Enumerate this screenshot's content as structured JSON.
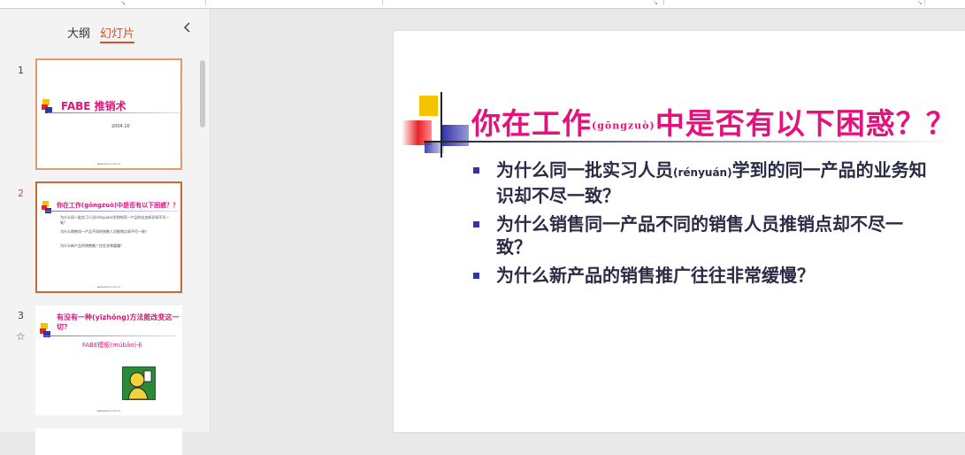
{
  "panel": {
    "tab_outline": "大纲",
    "tab_slides": "幻灯片",
    "collapse_icon": "chevron-left-icon"
  },
  "slides": [
    {
      "number": "1",
      "title": "FABE 推销术",
      "date": "2004.10",
      "footer": "www.zixin.com.cn"
    },
    {
      "number": "2",
      "title": "你在工作(gōngzuò)中是否有以下困惑？？",
      "bullets": [
        "为什么同一批实习人员(rényuán)学到的同一产品的业务知识却不尽一致？",
        "为什么销售同一产品不同的销售人员推销点却不尽一致？",
        "为什么新产品的销售推广往往非常缓慢？"
      ],
      "footer": "www.zixin.com.cn"
    },
    {
      "number": "3",
      "title": "有没有一种(yīzhǒng)方法能改变这一切？",
      "subtitle": "FABE模板(múbǎn)卡",
      "footer": "www.zixin.com.cn"
    }
  ],
  "main_slide": {
    "title_before": "你在工作",
    "title_pinyin": "(gōngzuò)",
    "title_after": "中是否有以下困惑？？",
    "bullet1_part1": "为什么同一批实习人员",
    "bullet1_pinyin": "(rényuán)",
    "bullet1_part2": "学到的同一产品的业务知识却不尽一致？",
    "bullet2": "为什么销售同一产品不同的销售人员推销点却不尽一致？",
    "bullet3": "为什么新产品的销售推广往往非常缓慢？"
  },
  "colors": {
    "accent": "#d0532c",
    "title_pink": "#e5117d",
    "bullet_blue": "#3333aa",
    "deco_yellow": "#f5c400",
    "deco_red": "#e8232a"
  }
}
